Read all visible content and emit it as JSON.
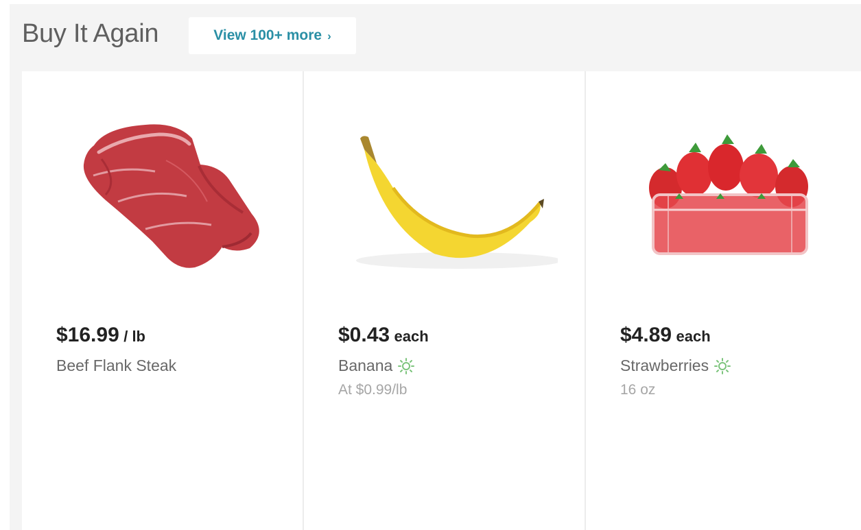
{
  "section": {
    "title": "Buy It Again",
    "view_more_label": "View 100+ more",
    "view_more_chevron": "›"
  },
  "colors": {
    "link": "#2a8fa5",
    "background": "#f4f4f4",
    "organic": "#7cc47c"
  },
  "products": [
    {
      "price": "$16.99",
      "unit": "/ lb",
      "name": "Beef Flank Steak",
      "subtext": "",
      "organic": false,
      "image_icon": "beef-steak-image"
    },
    {
      "price": "$0.43",
      "unit": "each",
      "name": "Banana",
      "subtext": "At $0.99/lb",
      "organic": true,
      "image_icon": "banana-image"
    },
    {
      "price": "$4.89",
      "unit": "each",
      "name": "Strawberries",
      "subtext": "16 oz",
      "organic": true,
      "image_icon": "strawberries-image"
    }
  ]
}
